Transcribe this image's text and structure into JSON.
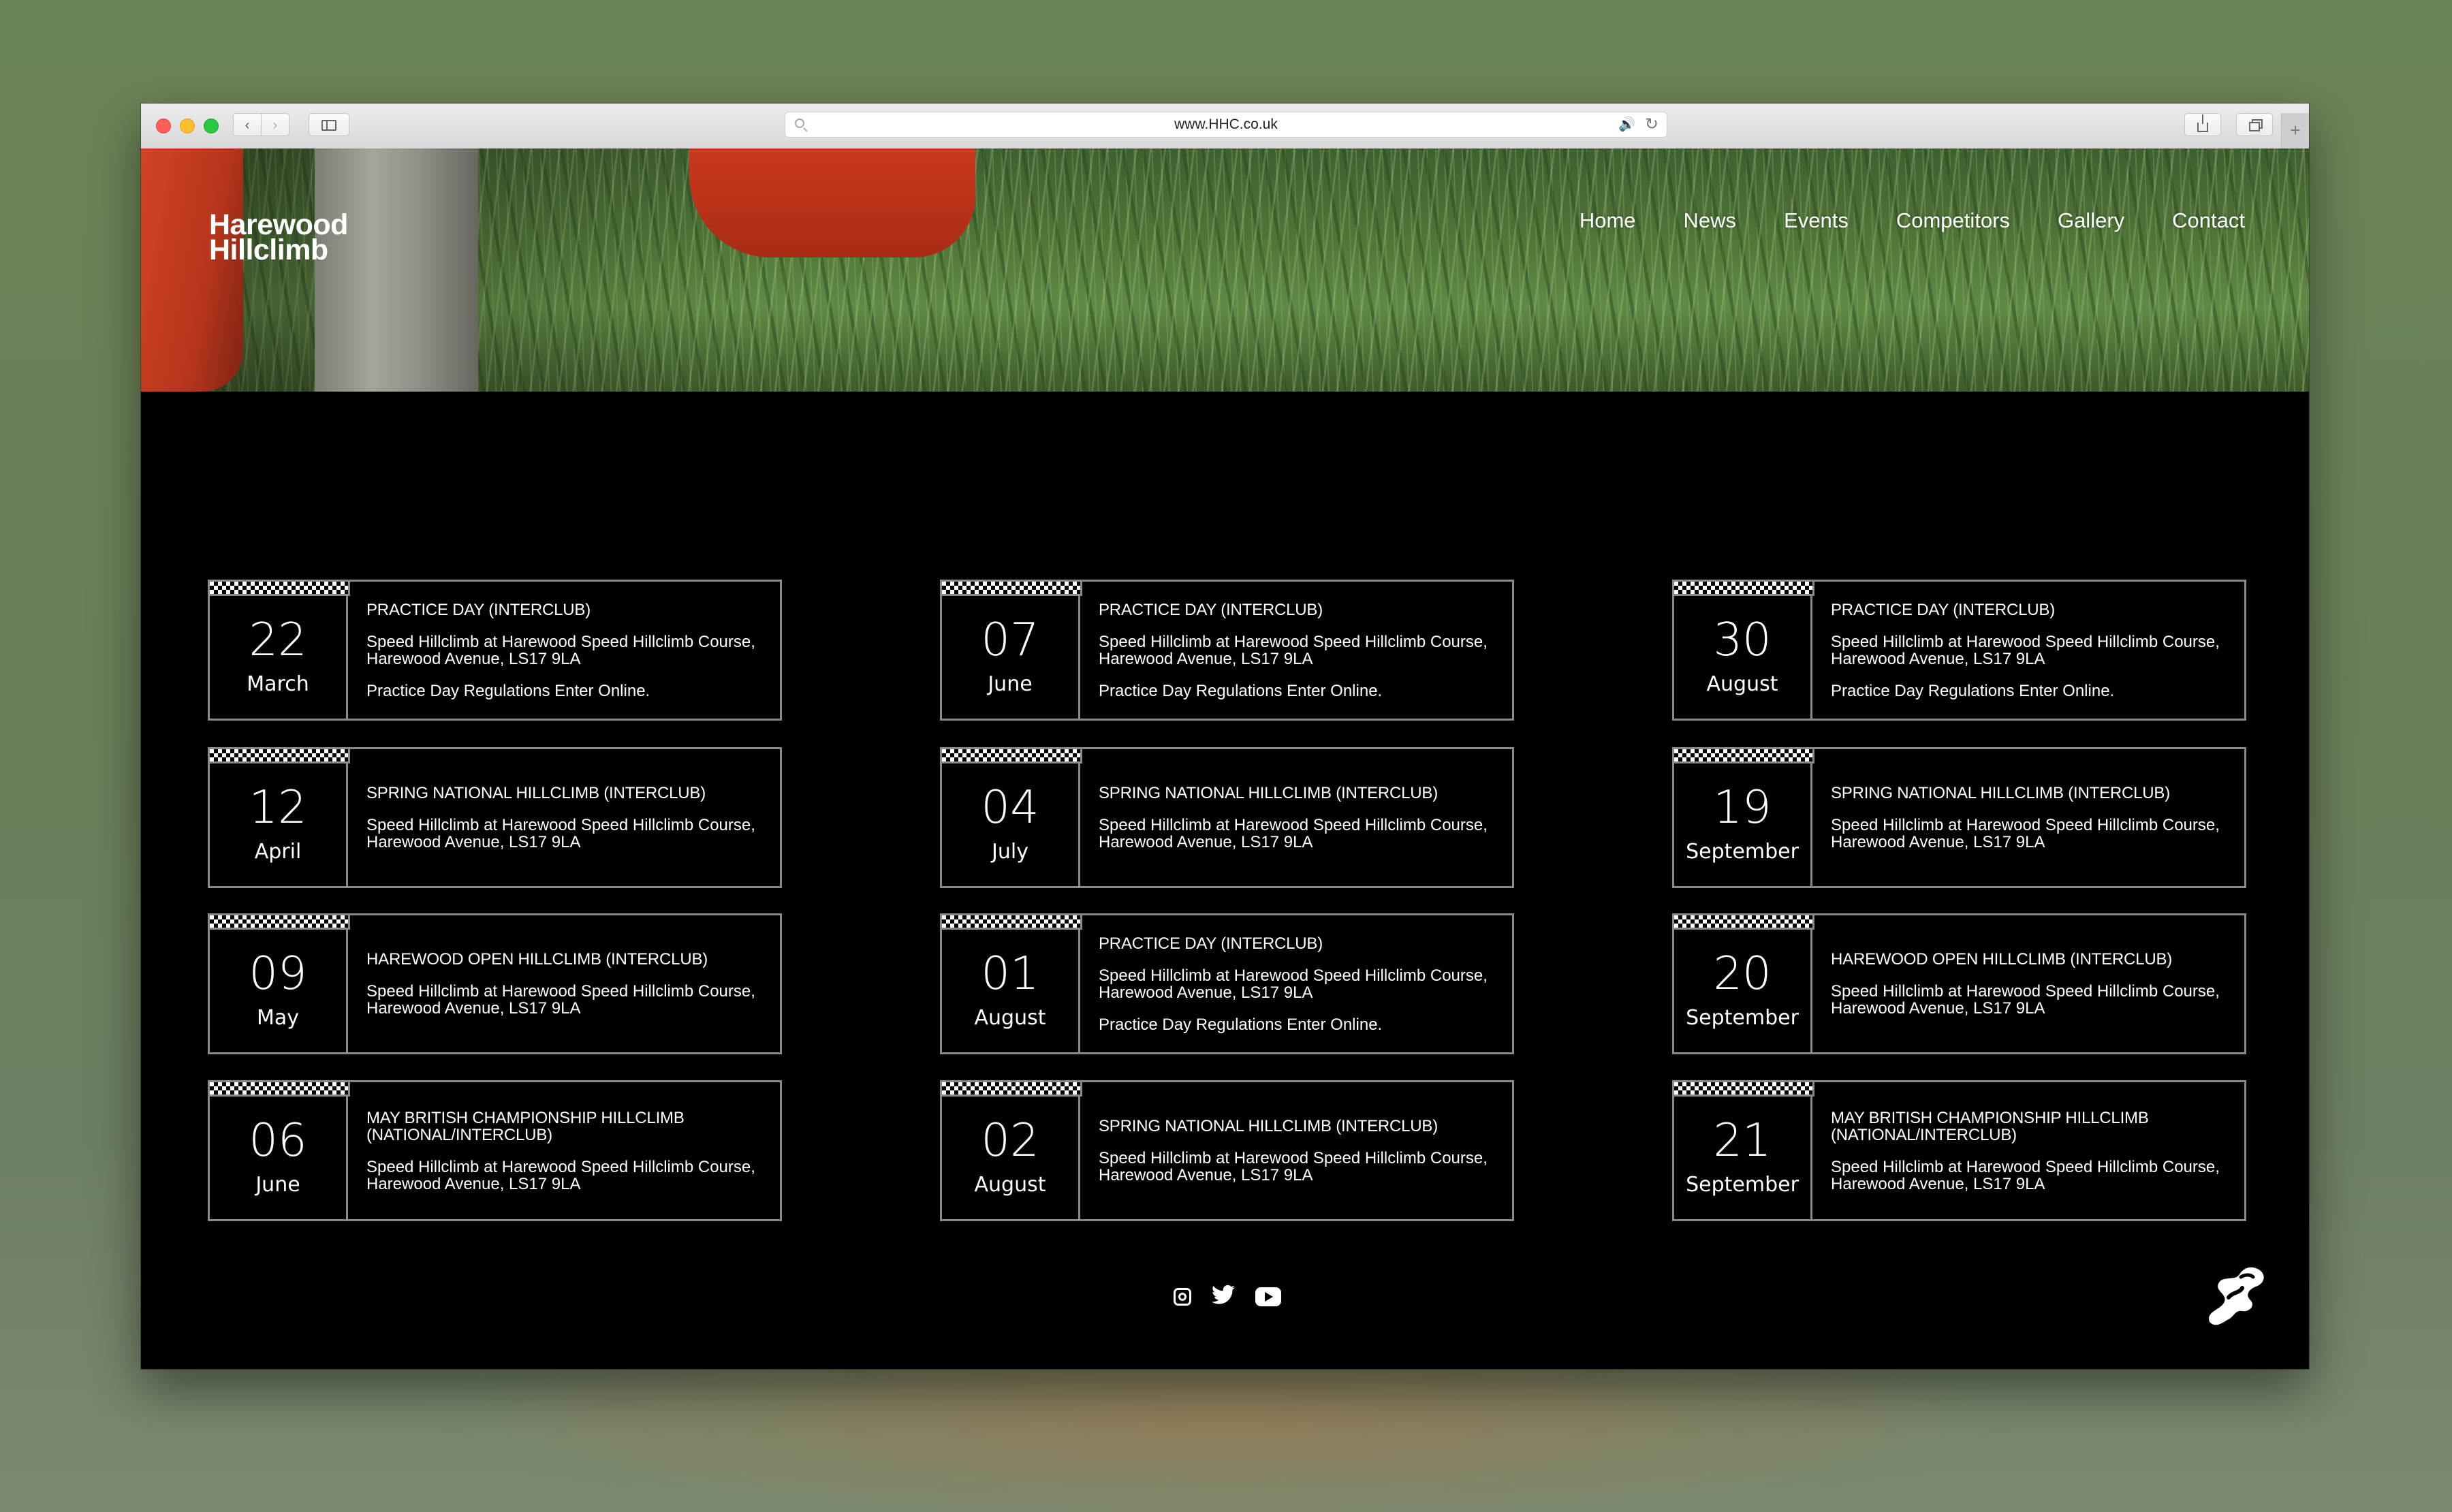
{
  "browser": {
    "url": "www.HHC.co.uk"
  },
  "site": {
    "brand_line1": "Harewood",
    "brand_line2": "Hillclimb",
    "nav": [
      "Home",
      "News",
      "Events",
      "Competitors",
      "Gallery",
      "Contact"
    ]
  },
  "events": {
    "columns": [
      [
        {
          "day": "22",
          "month": "March",
          "title": "PRACTICE DAY (INTERCLUB)",
          "venue": "Speed Hillclimb at Harewood Speed Hillclimb Course, Harewood Avenue, LS17 9LA",
          "regs": "Practice Day Regulations Enter Online."
        },
        {
          "day": "12",
          "month": "April",
          "title": "SPRING NATIONAL HILLCLIMB (INTERCLUB)",
          "venue": "Speed Hillclimb at Harewood Speed Hillclimb Course, Harewood Avenue, LS17 9LA",
          "regs": ""
        },
        {
          "day": "09",
          "month": "May",
          "title": "HAREWOOD OPEN HILLCLIMB (INTERCLUB)",
          "venue": "Speed Hillclimb at Harewood Speed Hillclimb Course, Harewood Avenue, LS17 9LA",
          "regs": ""
        },
        {
          "day": "06",
          "month": "June",
          "title": "MAY BRITISH CHAMPIONSHIP HILLCLIMB (NATIONAL/INTERCLUB)",
          "venue": "Speed Hillclimb at Harewood Speed Hillclimb Course, Harewood Avenue, LS17 9LA",
          "regs": ""
        }
      ],
      [
        {
          "day": "07",
          "month": "June",
          "title": "PRACTICE DAY (INTERCLUB)",
          "venue": "Speed Hillclimb at Harewood Speed Hillclimb Course, Harewood Avenue, LS17 9LA",
          "regs": "Practice Day Regulations Enter Online."
        },
        {
          "day": "04",
          "month": "July",
          "title": "SPRING NATIONAL HILLCLIMB (INTERCLUB)",
          "venue": "Speed Hillclimb at Harewood Speed Hillclimb Course, Harewood Avenue, LS17 9LA",
          "regs": ""
        },
        {
          "day": "01",
          "month": "August",
          "title": "PRACTICE DAY (INTERCLUB)",
          "venue": "Speed Hillclimb at Harewood Speed Hillclimb Course, Harewood Avenue, LS17 9LA",
          "regs": "Practice Day Regulations Enter Online."
        },
        {
          "day": "02",
          "month": "August",
          "title": "SPRING NATIONAL HILLCLIMB (INTERCLUB)",
          "venue": "Speed Hillclimb at Harewood Speed Hillclimb Course, Harewood Avenue, LS17 9LA",
          "regs": ""
        }
      ],
      [
        {
          "day": "30",
          "month": "August",
          "title": "PRACTICE DAY (INTERCLUB)",
          "venue": "Speed Hillclimb at Harewood Speed Hillclimb Course, Harewood Avenue, LS17 9LA",
          "regs": "Practice Day Regulations Enter Online."
        },
        {
          "day": "19",
          "month": "September",
          "title": "SPRING NATIONAL HILLCLIMB (INTERCLUB)",
          "venue": "Speed Hillclimb at Harewood Speed Hillclimb Course, Harewood Avenue, LS17 9LA",
          "regs": ""
        },
        {
          "day": "20",
          "month": "September",
          "title": "HAREWOOD OPEN HILLCLIMB (INTERCLUB)",
          "venue": "Speed Hillclimb at Harewood Speed Hillclimb Course, Harewood Avenue, LS17 9LA",
          "regs": ""
        },
        {
          "day": "21",
          "month": "September",
          "title": "MAY BRITISH CHAMPIONSHIP HILLCLIMB (NATIONAL/INTERCLUB)",
          "venue": "Speed Hillclimb at Harewood Speed Hillclimb Course, Harewood Avenue, LS17 9LA",
          "regs": ""
        }
      ]
    ]
  },
  "footer": {
    "social_icons": [
      "instagram-icon",
      "twitter-icon",
      "youtube-icon"
    ],
    "logo_icon": "hhc-logo-icon"
  },
  "colors": {
    "page_background": "#000000",
    "card_border": "#8a8a8a",
    "text": "#ffffff"
  }
}
